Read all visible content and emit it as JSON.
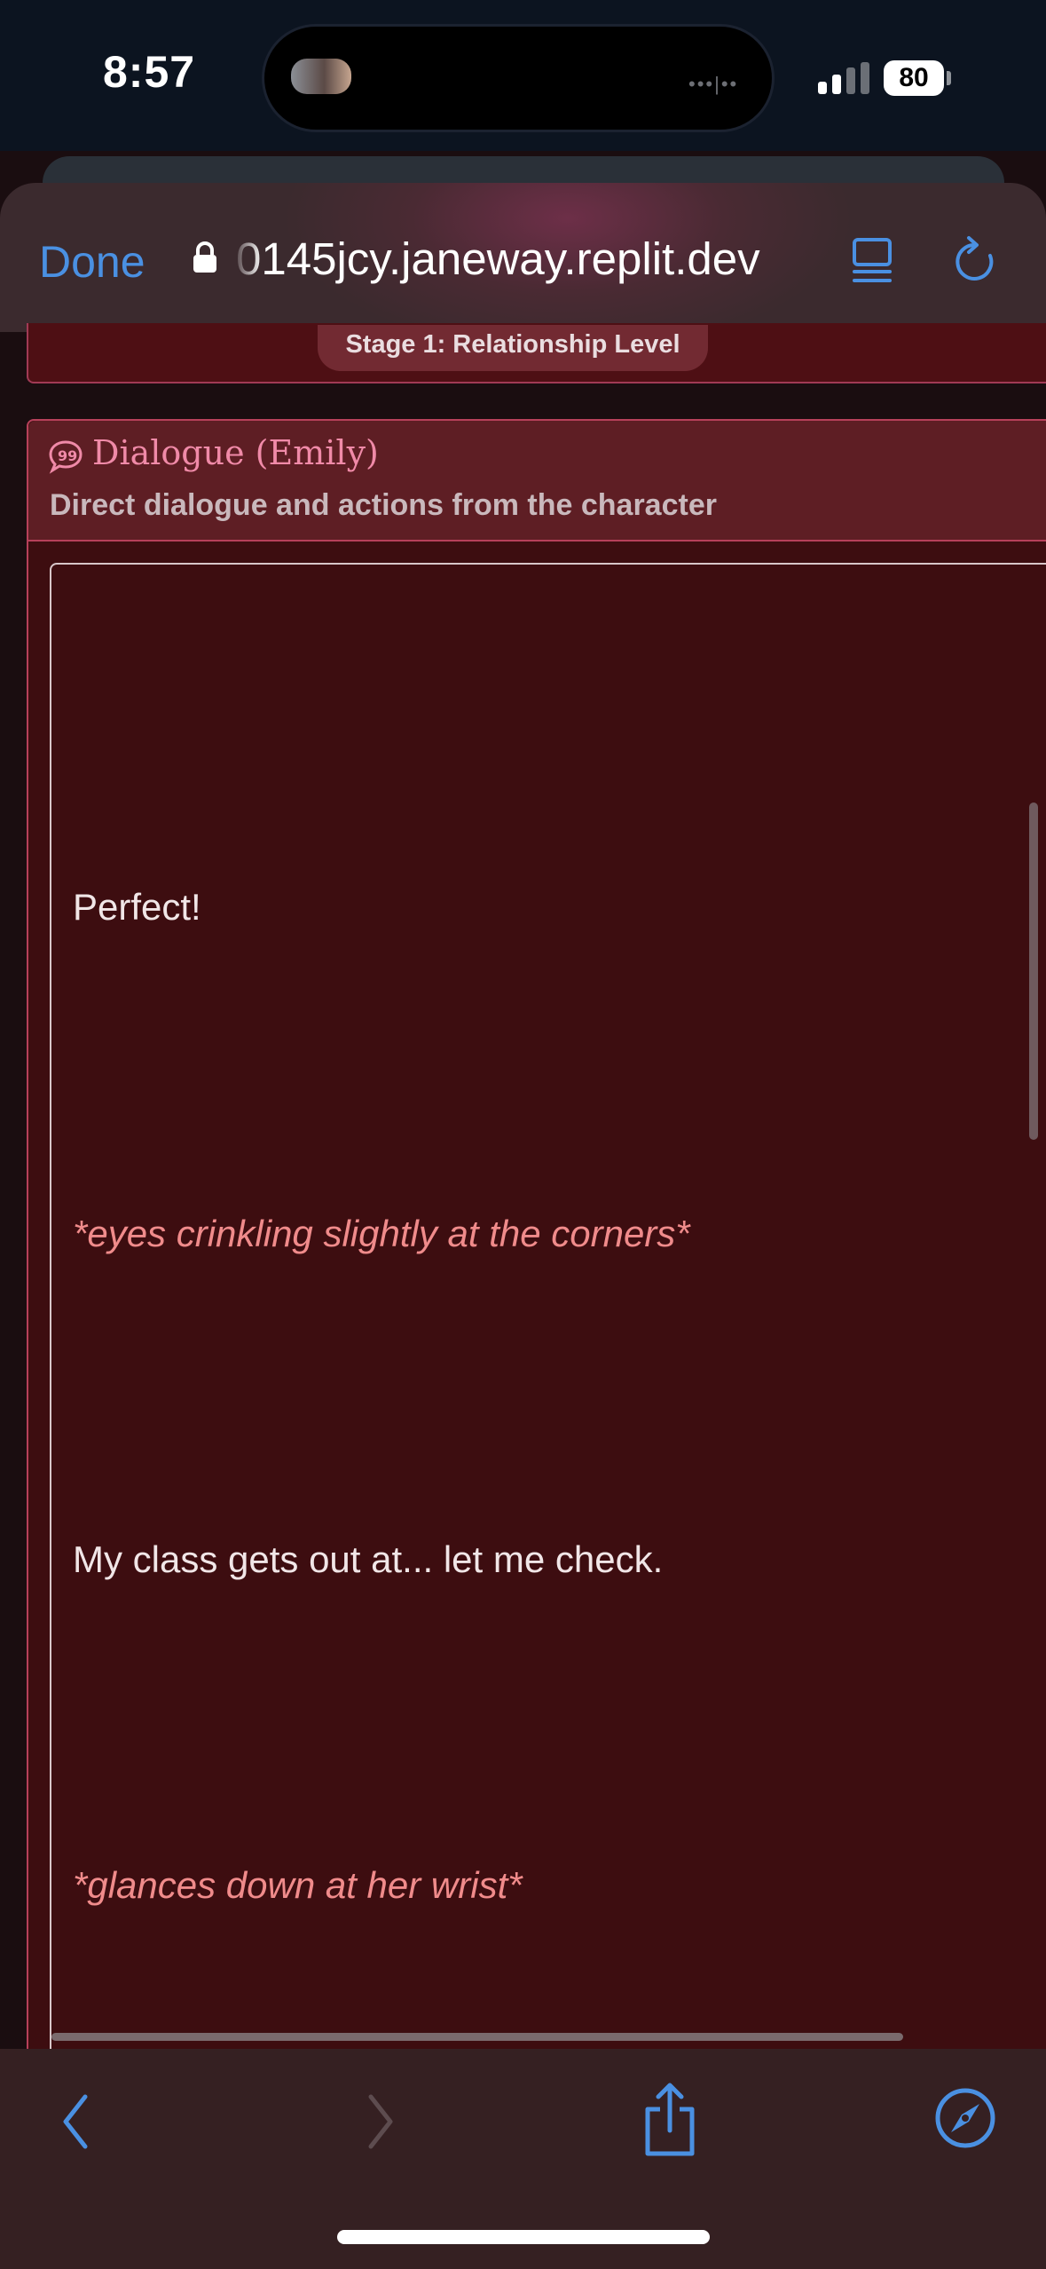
{
  "status_bar": {
    "time": "8:57",
    "battery": "80",
    "signal_bars": 2,
    "icons": [
      "signal-icon",
      "battery-icon"
    ]
  },
  "browser": {
    "done_label": "Done",
    "url": "0145jcy.janeway.replit.dev",
    "icons": [
      "lock-icon",
      "reader-icon",
      "reload-icon",
      "back-icon",
      "forward-icon",
      "share-icon",
      "compass-icon"
    ]
  },
  "page": {
    "stage_label": "Stage 1: Relationship Level",
    "dialogue": {
      "title": "Dialogue (Emily)",
      "subtitle": "Direct dialogue and actions from the character",
      "messages": [
        {
          "type": "speech",
          "text": "Perfect!"
        },
        {
          "type": "action",
          "text": "*eyes crinkling slightly at the corners*"
        },
        {
          "type": "speech",
          "text": "My class gets out at... let me check."
        },
        {
          "type": "action",
          "text": "*glances down at her wrist*"
        }
      ]
    }
  },
  "colors": {
    "accent": "#4a90e2",
    "card_bg": "#3d0d10",
    "card_border": "#b7405a",
    "title_pink": "#f08aa8",
    "action_text": "#f08b8b"
  }
}
